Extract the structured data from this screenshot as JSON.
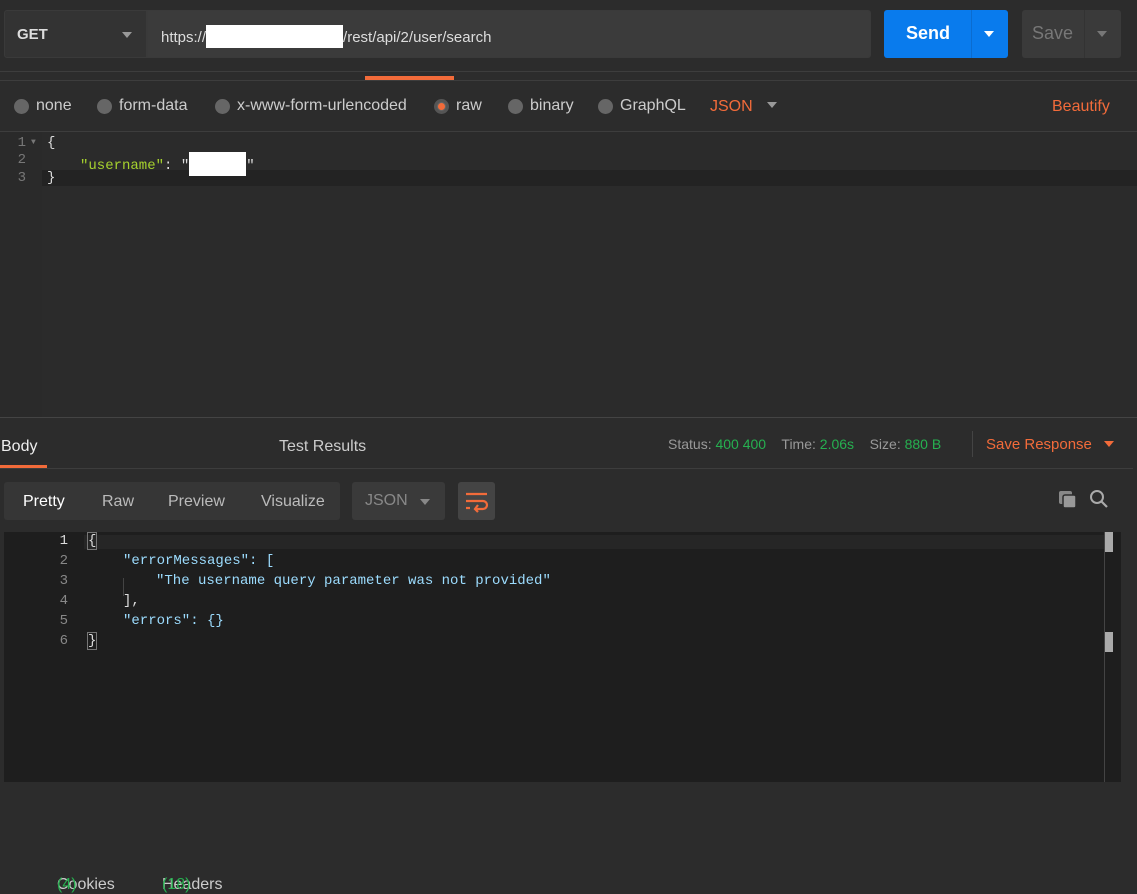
{
  "request": {
    "method": "GET",
    "url_prefix": "https://",
    "url_suffix": "/rest/api/2/user/search",
    "send_label": "Send",
    "save_label": "Save"
  },
  "body_types": [
    {
      "label": "none",
      "selected": false
    },
    {
      "label": "form-data",
      "selected": false
    },
    {
      "label": "x-www-form-urlencoded",
      "selected": false
    },
    {
      "label": "raw",
      "selected": true
    },
    {
      "label": "binary",
      "selected": false
    },
    {
      "label": "GraphQL",
      "selected": false
    }
  ],
  "raw_format": "JSON",
  "beautify_label": "Beautify",
  "request_body": {
    "line_numbers": [
      "1",
      "2",
      "3"
    ],
    "open": "{",
    "key": "\"username\"",
    "colon": ": ",
    "quote_open": "\"",
    "quote_close": "\"",
    "close": "}"
  },
  "response_tabs": [
    {
      "label": "Body"
    },
    {
      "label": "Cookies",
      "count": "(4)"
    },
    {
      "label": "Headers",
      "count": "(18)"
    },
    {
      "label": "Test Results"
    }
  ],
  "status": {
    "status_label": "Status:",
    "status_value": "400 400",
    "time_label": "Time:",
    "time_value": "2.06s",
    "size_label": "Size:",
    "size_value": "880 B",
    "save_response": "Save Response"
  },
  "view_modes": [
    "Pretty",
    "Raw",
    "Preview",
    "Visualize"
  ],
  "response_format": "JSON",
  "response_body": {
    "line_numbers": [
      "1",
      "2",
      "3",
      "4",
      "5",
      "6"
    ],
    "lines": [
      "{",
      "\"errorMessages\": [",
      "\"The username query parameter was not provided\"",
      "],",
      "\"errors\": {}",
      "}"
    ]
  },
  "colors": {
    "accent": "#f26b3a",
    "send": "#097bed",
    "success": "#26b050"
  }
}
